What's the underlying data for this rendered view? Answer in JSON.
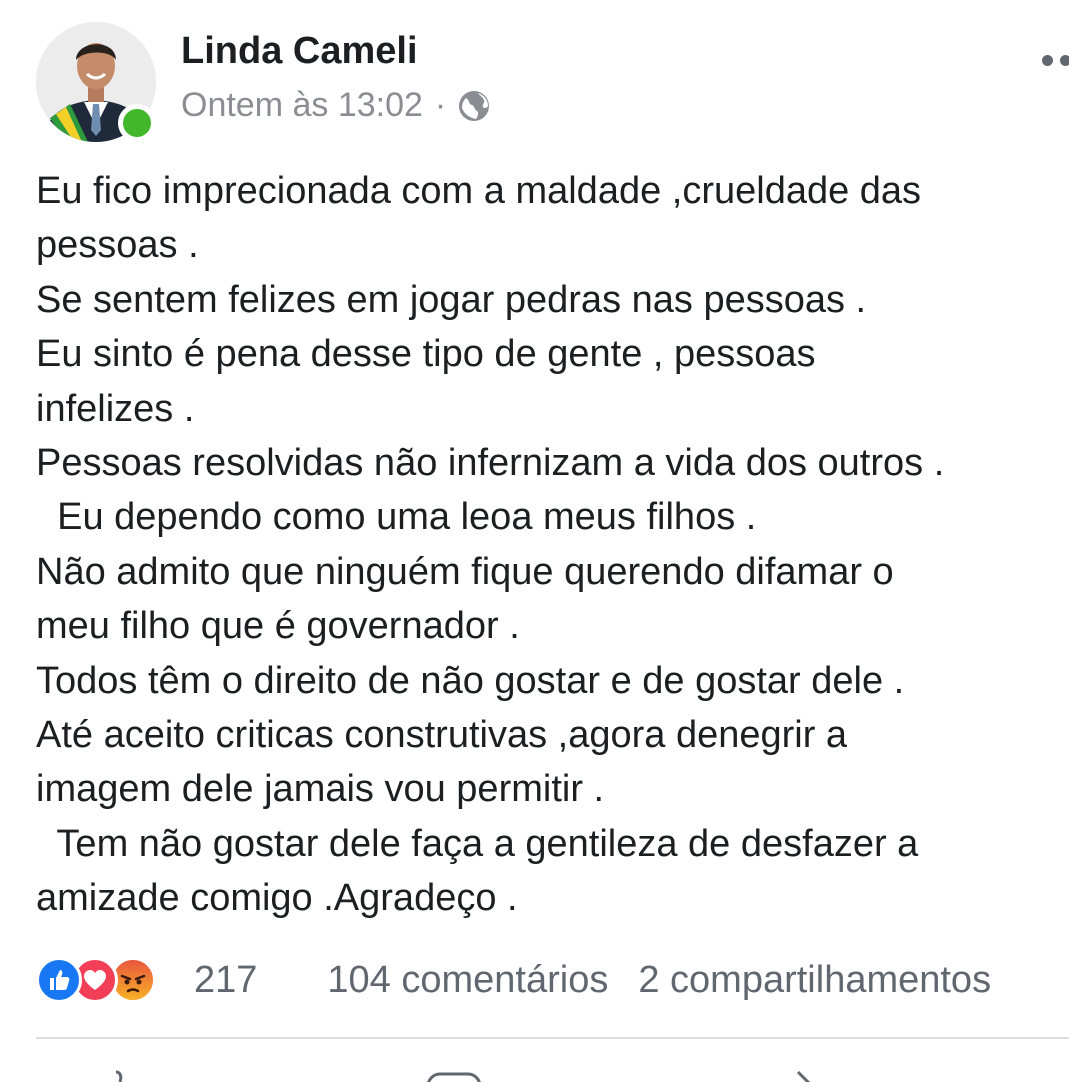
{
  "post": {
    "author": "Linda Cameli",
    "timestamp": "Ontem às 13:02",
    "separator": "·",
    "privacy_icon": "globe-icon",
    "avatar_icon": "profile-photo",
    "online": true,
    "more_icon": "more-options-icon",
    "text_lines": [
      "Eu fico imprecionada com a maldade ,crueldade das",
      "pessoas .",
      "Se sentem felizes em jogar pedras nas pessoas .",
      "Eu sinto é pena desse tipo de gente , pessoas",
      "infelizes .",
      "Pessoas resolvidas não infernizam a vida dos outros .",
      "  Eu dependo como uma leoa meus filhos .",
      "Não admito que ninguém fique querendo difamar o",
      "meu filho que é governador .",
      "Todos têm o direito de não gostar e de gostar dele .",
      "Até aceito criticas construtivas ,agora denegrir a",
      "imagem dele jamais vou permitir .",
      "  Tem não gostar dele faça a gentileza de desfazer a",
      "amizade comigo .Agradeço ."
    ]
  },
  "engagement": {
    "reaction_icons": [
      "like-icon",
      "love-icon",
      "angry-icon"
    ],
    "reactions_count": "217",
    "comments": "104 comentários",
    "shares": "2 compartilhamentos"
  },
  "actions": {
    "icons": [
      "like-action-icon",
      "comment-action-icon",
      "share-action-icon"
    ]
  },
  "colors": {
    "online": "#42b72a",
    "like": "#1877f2",
    "love": "#f33e58",
    "angry": "#f7714b",
    "text": "#1c1e21",
    "muted": "#8a8d91"
  }
}
